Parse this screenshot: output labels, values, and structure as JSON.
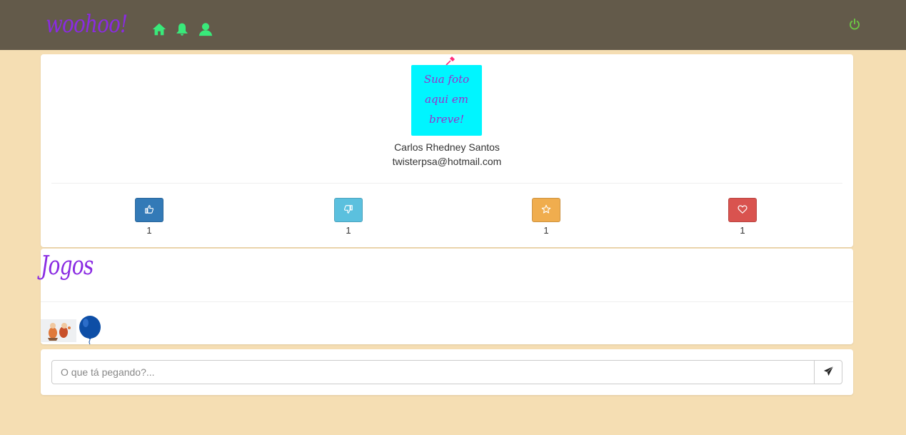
{
  "navbar": {
    "brand": "woohoo!",
    "icons": [
      "home-icon",
      "bell-icon",
      "user-icon"
    ],
    "logout_icon": "power-icon",
    "icon_color": "#39e97a",
    "logout_color": "#6cc644"
  },
  "profile": {
    "photo_note": "Sua foto aqui em breve!",
    "name": "Carlos Rhedney Santos",
    "email": "twisterpsa@hotmail.com",
    "reactions": [
      {
        "icon": "thumbs-up-icon",
        "count": "1",
        "color": "#337ab7"
      },
      {
        "icon": "thumbs-down-icon",
        "count": "1",
        "color": "#5bc0de"
      },
      {
        "icon": "star-icon",
        "count": "1",
        "color": "#f0ad4e"
      },
      {
        "icon": "heart-icon",
        "count": "1",
        "color": "#d9534f"
      }
    ]
  },
  "jogos": {
    "title": "Jogos",
    "items": [
      "game-thumbnail",
      "balloon-game-icon"
    ]
  },
  "post": {
    "placeholder": "O que tá pegando?...",
    "send_icon": "send-icon"
  }
}
